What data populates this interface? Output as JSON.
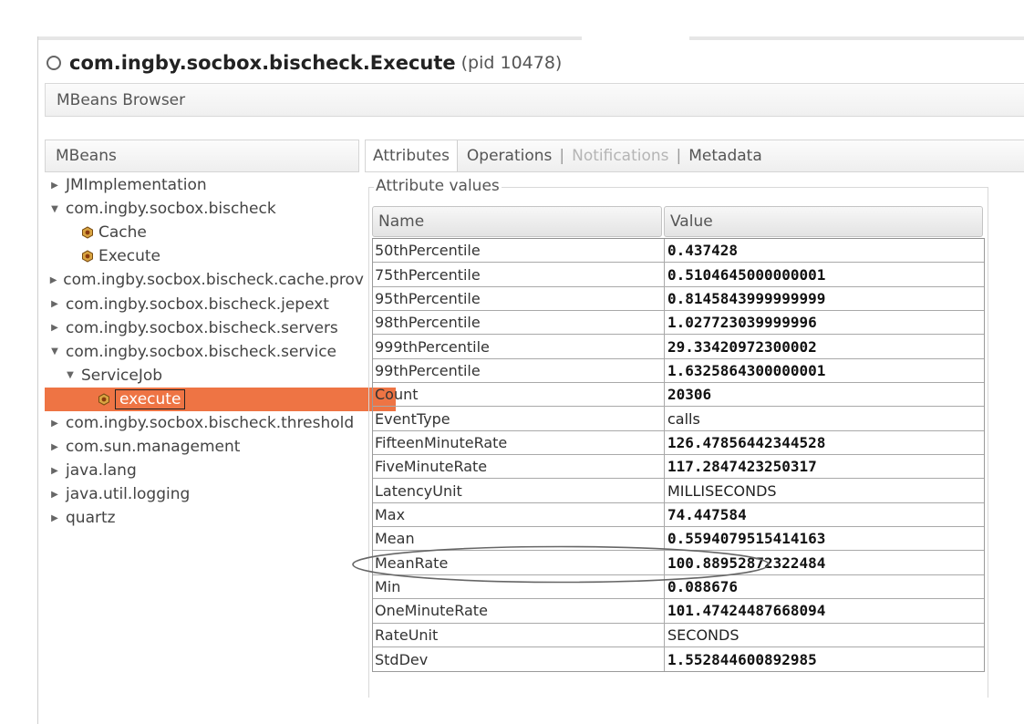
{
  "window": {
    "title_main": "com.ingby.socbox.bischeck.Execute",
    "title_pid": "(pid 10478)",
    "subheader": "MBeans Browser"
  },
  "mbeans_panel": {
    "header": "MBeans",
    "tree": [
      {
        "label": "JMImplementation",
        "expander": "collapsed",
        "depth": 0,
        "icon": null
      },
      {
        "label": "com.ingby.socbox.bischeck",
        "expander": "expanded",
        "depth": 0,
        "icon": null
      },
      {
        "label": "Cache",
        "expander": "none",
        "depth": 1,
        "icon": "bean-icon"
      },
      {
        "label": "Execute",
        "expander": "none",
        "depth": 1,
        "icon": "bean-icon"
      },
      {
        "label": "com.ingby.socbox.bischeck.cache.prov",
        "expander": "collapsed",
        "depth": 0,
        "icon": null
      },
      {
        "label": "com.ingby.socbox.bischeck.jepext",
        "expander": "collapsed",
        "depth": 0,
        "icon": null
      },
      {
        "label": "com.ingby.socbox.bischeck.servers",
        "expander": "collapsed",
        "depth": 0,
        "icon": null
      },
      {
        "label": "com.ingby.socbox.bischeck.service",
        "expander": "expanded",
        "depth": 0,
        "icon": null
      },
      {
        "label": "ServiceJob",
        "expander": "expanded",
        "depth": 1,
        "icon": null
      },
      {
        "label": "execute",
        "expander": "none",
        "depth": 2,
        "icon": "bean-icon",
        "selected": true
      },
      {
        "label": "com.ingby.socbox.bischeck.threshold",
        "expander": "collapsed",
        "depth": 0,
        "icon": null
      },
      {
        "label": "com.sun.management",
        "expander": "collapsed",
        "depth": 0,
        "icon": null
      },
      {
        "label": "java.lang",
        "expander": "collapsed",
        "depth": 0,
        "icon": null
      },
      {
        "label": "java.util.logging",
        "expander": "collapsed",
        "depth": 0,
        "icon": null
      },
      {
        "label": "quartz",
        "expander": "collapsed",
        "depth": 0,
        "icon": null
      }
    ]
  },
  "tabs": [
    {
      "label": "Attributes",
      "state": "active"
    },
    {
      "label": "Operations",
      "state": "normal"
    },
    {
      "label": "Notifications",
      "state": "disabled"
    },
    {
      "label": "Metadata",
      "state": "normal"
    }
  ],
  "attributes": {
    "group_title": "Attribute values",
    "columns": {
      "name": "Name",
      "value": "Value"
    },
    "rows": [
      {
        "name": "50thPercentile",
        "value": "0.437428",
        "numeric": true
      },
      {
        "name": "75thPercentile",
        "value": "0.5104645000000001",
        "numeric": true
      },
      {
        "name": "95thPercentile",
        "value": "0.8145843999999999",
        "numeric": true
      },
      {
        "name": "98thPercentile",
        "value": "1.027723039999996",
        "numeric": true
      },
      {
        "name": "999thPercentile",
        "value": "29.33420972300002",
        "numeric": true
      },
      {
        "name": "99thPercentile",
        "value": "1.6325864300000001",
        "numeric": true
      },
      {
        "name": "Count",
        "value": "20306",
        "numeric": true
      },
      {
        "name": "EventType",
        "value": "calls",
        "numeric": false
      },
      {
        "name": "FifteenMinuteRate",
        "value": "126.47856442344528",
        "numeric": true
      },
      {
        "name": "FiveMinuteRate",
        "value": "117.2847423250317",
        "numeric": true
      },
      {
        "name": "LatencyUnit",
        "value": "MILLISECONDS",
        "numeric": false
      },
      {
        "name": "Max",
        "value": "74.447584",
        "numeric": true
      },
      {
        "name": "Mean",
        "value": "0.5594079515414163",
        "numeric": true
      },
      {
        "name": "MeanRate",
        "value": "100.88952872322484",
        "numeric": true,
        "annotated": true
      },
      {
        "name": "Min",
        "value": "0.088676",
        "numeric": true
      },
      {
        "name": "OneMinuteRate",
        "value": "101.47424487668094",
        "numeric": true
      },
      {
        "name": "RateUnit",
        "value": "SECONDS",
        "numeric": false
      },
      {
        "name": "StdDev",
        "value": "1.552844600892985",
        "numeric": true
      }
    ]
  },
  "colors": {
    "selection": "#ee7444",
    "annotation_ellipse": "#666666"
  }
}
